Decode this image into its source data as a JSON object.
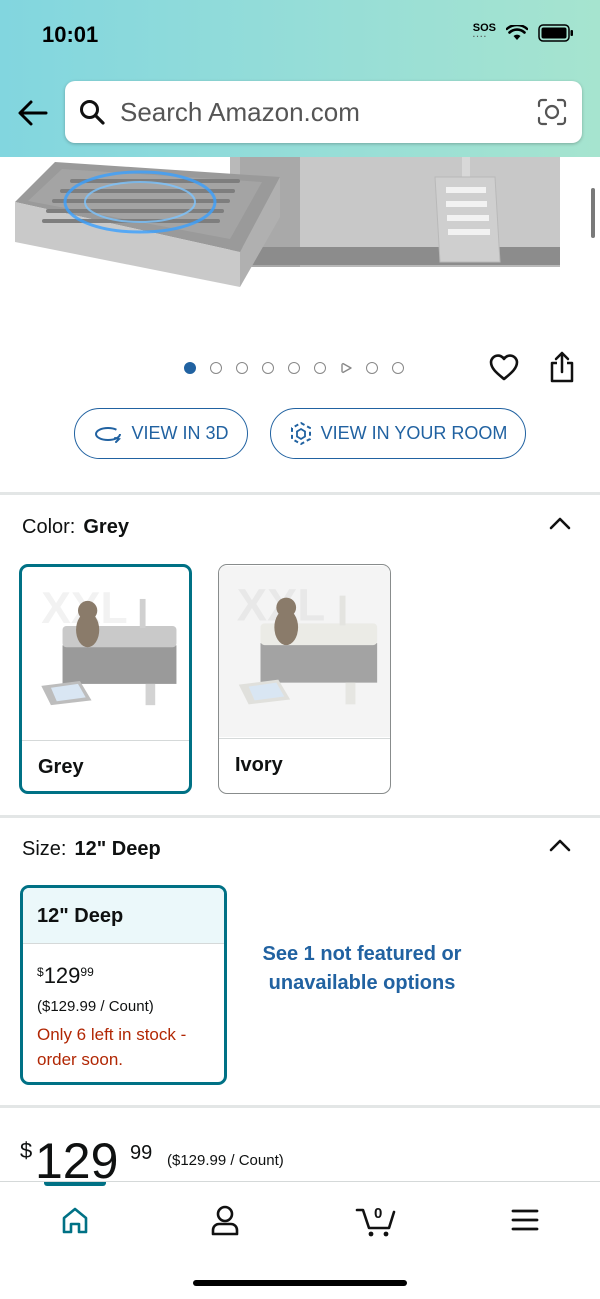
{
  "status_bar": {
    "time": "10:01",
    "sos": "SOS"
  },
  "search": {
    "placeholder": "Search Amazon.com"
  },
  "gallery": {
    "image_count": 9,
    "active_index": 0,
    "video_index": 6
  },
  "actions": {
    "view_3d": "VIEW IN 3D",
    "view_room": "VIEW IN YOUR ROOM"
  },
  "color": {
    "label": "Color:",
    "selected": "Grey",
    "options": [
      {
        "label": "Grey",
        "selected": true,
        "watermark": "XXL"
      },
      {
        "label": "Ivory",
        "selected": false,
        "watermark": "XXL"
      }
    ]
  },
  "size": {
    "label": "Size:",
    "selected": "12\" Deep",
    "card": {
      "title": "12\" Deep",
      "currency": "$",
      "price_whole": "129",
      "price_fraction": "99",
      "unit_price": "($129.99 / Count)",
      "stock": "Only 6 left in stock - order soon."
    },
    "not_featured": "See 1 not featured or unavailable options"
  },
  "price": {
    "currency": "$",
    "whole": "129",
    "fraction": "99",
    "unit_price": "($129.99 / Count)"
  },
  "tabbar": {
    "items": [
      "home-icon",
      "account-icon",
      "cart-icon",
      "menu-icon"
    ],
    "active": "home-icon",
    "cart_count": "0"
  },
  "colors": {
    "accent": "#007185",
    "link": "#2162a1",
    "stock": "#b12704"
  }
}
